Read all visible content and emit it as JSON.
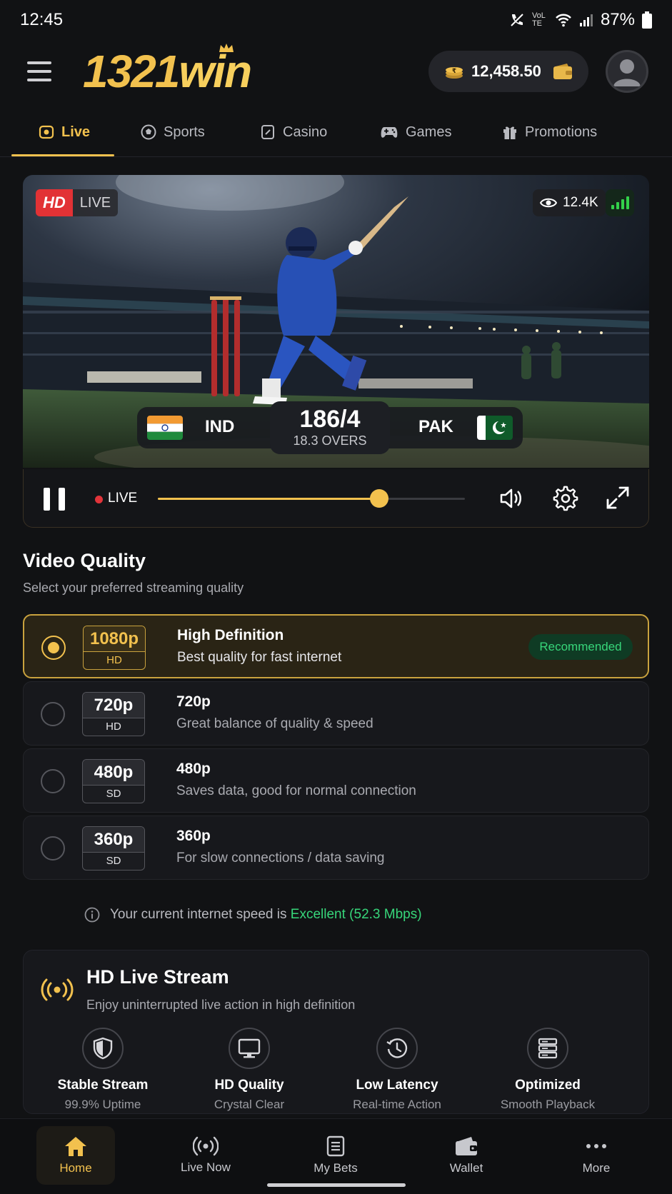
{
  "status_bar": {
    "time": "12:45",
    "battery": "87%",
    "network": "VoLTE"
  },
  "header": {
    "logo_num": "1321",
    "logo_text": "win",
    "balance": "12,458.50"
  },
  "tabs": [
    {
      "label": "Live",
      "icon": "live-tv-icon"
    },
    {
      "label": "Sports",
      "icon": "soccer-ball-icon"
    },
    {
      "label": "Casino",
      "icon": "card-icon"
    },
    {
      "label": "Games",
      "icon": "gamepad-icon"
    },
    {
      "label": "Promotions",
      "icon": "gift-icon"
    }
  ],
  "video": {
    "hd_label": "HD",
    "live_label": "LIVE",
    "viewers": "12.4K",
    "team_home": "IND",
    "team_away": "PAK",
    "score": "186/4",
    "overs": "18.3 OVERS",
    "controls_live": "LIVE",
    "progress": 0.72
  },
  "video_quality": {
    "title": "Video Quality",
    "subtitle": "Select your preferred streaming quality",
    "options": [
      {
        "res": "1080p",
        "tier": "HD",
        "name": "High Definition",
        "desc": "Best quality for fast internet",
        "badge": "Recommended",
        "selected": true
      },
      {
        "res": "720p",
        "tier": "HD",
        "name": "720p",
        "desc": "Great balance of quality & speed",
        "selected": false
      },
      {
        "res": "480p",
        "tier": "SD",
        "name": "480p",
        "desc": "Saves data, good for normal connection",
        "selected": false
      },
      {
        "res": "360p",
        "tier": "SD",
        "name": "360p",
        "desc": "For slow connections / data saving",
        "selected": false
      }
    ],
    "speed_prefix": "Your current internet speed is",
    "speed_value": "Excellent (52.3 Mbps)"
  },
  "stream_card": {
    "title": "HD Live Stream",
    "subtitle": "Enjoy uninterrupted live action in high definition",
    "features": [
      {
        "name": "Stable Stream",
        "desc": "99.9% Uptime",
        "icon": "shield-icon"
      },
      {
        "name": "HD Quality",
        "desc": "Crystal Clear",
        "icon": "monitor-icon"
      },
      {
        "name": "Low Latency",
        "desc": "Real-time Action",
        "icon": "clock-icon"
      },
      {
        "name": "Optimized",
        "desc": "Smooth Playback",
        "icon": "server-icon"
      }
    ]
  },
  "bottom_nav": [
    {
      "label": "Home",
      "icon": "home-icon",
      "active": true
    },
    {
      "label": "Live Now",
      "icon": "broadcast-icon"
    },
    {
      "label": "My Bets",
      "icon": "receipt-icon"
    },
    {
      "label": "Wallet",
      "icon": "wallet-icon"
    },
    {
      "label": "More",
      "icon": "more-dots-icon"
    }
  ],
  "colors": {
    "accent": "#f2c14e",
    "live_red": "#e2343a",
    "success": "#37d67a",
    "background": "#111214"
  }
}
